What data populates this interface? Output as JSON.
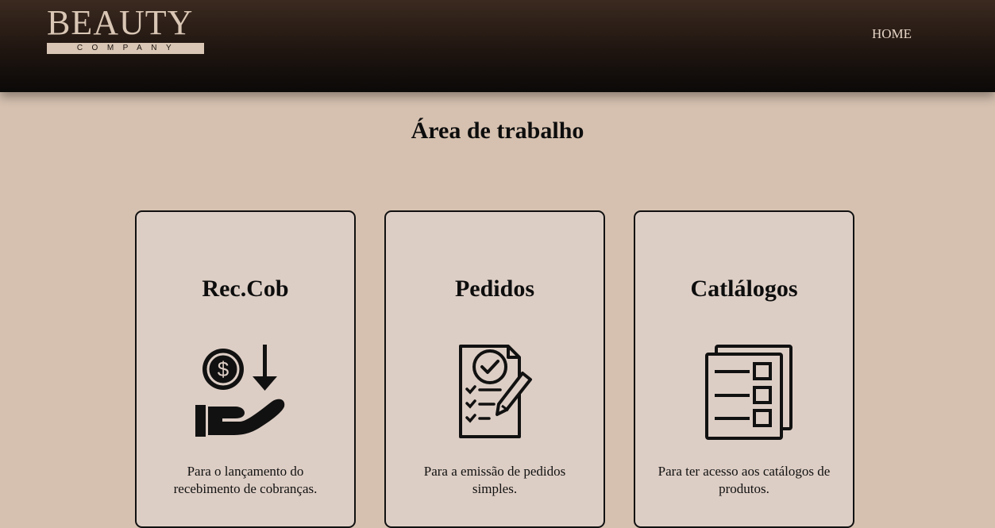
{
  "header": {
    "logo_main": "BEAUTY",
    "logo_sub": "COMPANY",
    "nav_home": "HOME"
  },
  "main": {
    "title": "Área de trabalho",
    "cards": [
      {
        "title": "Rec.Cob",
        "icon": "hand-money-icon",
        "description": "Para o lançamento do recebimento de cobranças."
      },
      {
        "title": "Pedidos",
        "icon": "order-checklist-icon",
        "description": "Para a emissão de pedidos simples."
      },
      {
        "title": "Catlálogos",
        "icon": "catalog-icon",
        "description": "Para ter acesso aos catálogos de produtos."
      }
    ]
  },
  "colors": {
    "background": "#d6c1b0",
    "header_dark": "#1f1510",
    "card_bg": "#ddcec5",
    "logo": "#d9c6b4"
  }
}
